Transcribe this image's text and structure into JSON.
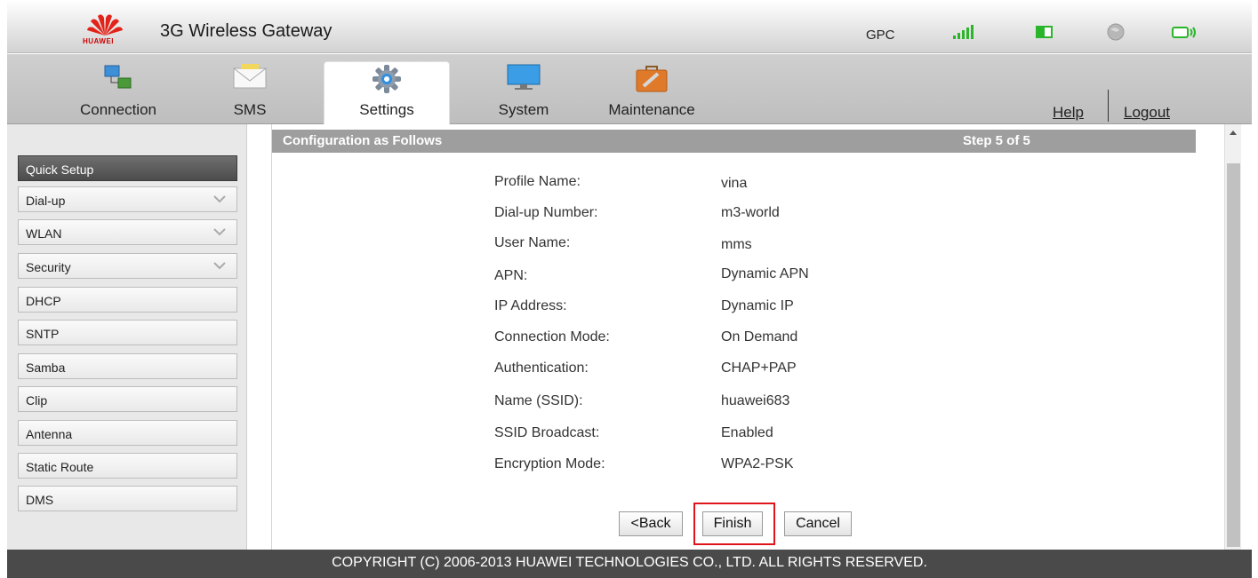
{
  "header": {
    "logo_text": "HUAWEI",
    "title": "3G Wireless Gateway",
    "carrier": "GPC",
    "status_icons": [
      "signal-strength-icon",
      "battery-icon",
      "globe-icon",
      "wlan-icon"
    ]
  },
  "nav": {
    "tabs": [
      {
        "label": "Connection",
        "icon": "connection-icon",
        "active": false
      },
      {
        "label": "SMS",
        "icon": "envelope-icon",
        "active": false
      },
      {
        "label": "Settings",
        "icon": "gear-icon",
        "active": true
      },
      {
        "label": "System",
        "icon": "monitor-icon",
        "active": false
      },
      {
        "label": "Maintenance",
        "icon": "toolbox-icon",
        "active": false
      }
    ],
    "help": "Help",
    "logout": "Logout"
  },
  "sidebar": {
    "items": [
      {
        "label": "Quick Setup",
        "active": true,
        "expandable": false
      },
      {
        "label": "Dial-up",
        "active": false,
        "expandable": true
      },
      {
        "label": "WLAN",
        "active": false,
        "expandable": true
      },
      {
        "label": "Security",
        "active": false,
        "expandable": true
      },
      {
        "label": "DHCP",
        "active": false,
        "expandable": false
      },
      {
        "label": "SNTP",
        "active": false,
        "expandable": false
      },
      {
        "label": "Samba",
        "active": false,
        "expandable": false
      },
      {
        "label": "Clip",
        "active": false,
        "expandable": false
      },
      {
        "label": "Antenna",
        "active": false,
        "expandable": false
      },
      {
        "label": "Static Route",
        "active": false,
        "expandable": false
      },
      {
        "label": "DMS",
        "active": false,
        "expandable": false
      }
    ]
  },
  "main": {
    "heading": "Configuration as Follows",
    "step": "Step 5 of 5",
    "rows": [
      {
        "label": "Profile Name:",
        "value": "vina"
      },
      {
        "label": "Dial-up Number:",
        "value": "m3-world"
      },
      {
        "label": "User Name:",
        "value": "mms"
      },
      {
        "label": "APN:",
        "value": "Dynamic APN"
      },
      {
        "label": "IP Address:",
        "value": "Dynamic IP"
      },
      {
        "label": "Connection Mode:",
        "value": "On Demand"
      },
      {
        "label": "Authentication:",
        "value": "CHAP+PAP"
      },
      {
        "label": "Name (SSID):",
        "value": "huawei683"
      },
      {
        "label": "SSID Broadcast:",
        "value": "Enabled"
      },
      {
        "label": "Encryption Mode:",
        "value": "WPA2-PSK"
      }
    ],
    "buttons": {
      "back": "<Back",
      "finish": "Finish",
      "cancel": "Cancel"
    }
  },
  "footer": {
    "copyright": "COPYRIGHT (C) 2006-2013 HUAWEI TECHNOLOGIES CO., LTD. ALL RIGHTS RESERVED."
  },
  "colors": {
    "accent_red": "#e0141b",
    "signal_green": "#2bb52b",
    "footer_bg": "#4a4a4a",
    "section_header_bg": "#9e9e9e"
  }
}
